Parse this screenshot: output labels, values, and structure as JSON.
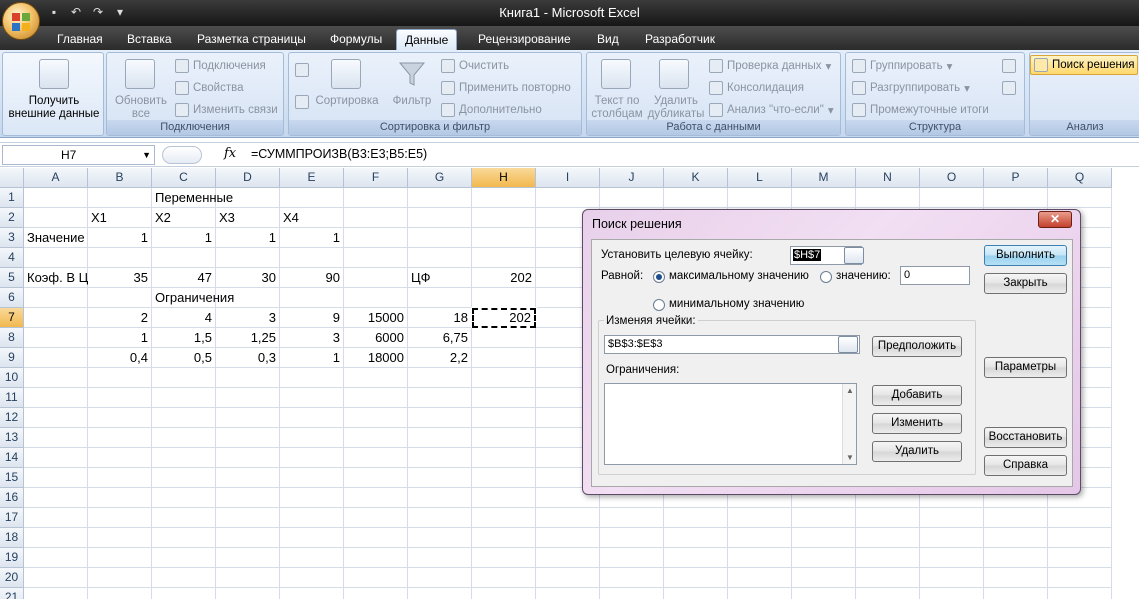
{
  "window": {
    "title": "Книга1 - Microsoft Excel"
  },
  "qat": {
    "save": "save-icon",
    "undo": "undo-icon",
    "redo": "redo-icon",
    "customize": "customize-qat-icon"
  },
  "tabs": [
    {
      "label": "Главная"
    },
    {
      "label": "Вставка"
    },
    {
      "label": "Разметка страницы"
    },
    {
      "label": "Формулы"
    },
    {
      "label": "Данные"
    },
    {
      "label": "Рецензирование"
    },
    {
      "label": "Вид"
    },
    {
      "label": "Разработчик"
    }
  ],
  "active_tab": "Данные",
  "ribbon": {
    "external": {
      "line1": "Получить",
      "line2": "внешние данные"
    },
    "connections": {
      "refresh_line1": "Обновить",
      "refresh_line2": "все",
      "connections": "Подключения",
      "properties": "Свойства",
      "edit_links": "Изменить связи",
      "group_label": "Подключения"
    },
    "sort_filter": {
      "sort": "Сортировка",
      "filter": "Фильтр",
      "clear": "Очистить",
      "reapply": "Применить повторно",
      "advanced": "Дополнительно",
      "group_label": "Сортировка и фильтр"
    },
    "data_tools": {
      "text_to_cols_line1": "Текст по",
      "text_to_cols_line2": "столбцам",
      "remove_dup_line1": "Удалить",
      "remove_dup_line2": "дубликаты",
      "validation": "Проверка данных",
      "consolidate": "Консолидация",
      "what_if": "Анализ \"что-если\"",
      "group_label": "Работа с данными"
    },
    "outline": {
      "group": "Группировать",
      "ungroup": "Разгруппировать",
      "subtotal": "Промежуточные итоги",
      "group_label": "Структура"
    },
    "analysis": {
      "solver": "Поиск решения",
      "group_label": "Анализ"
    }
  },
  "formula_bar": {
    "name_box": "H7",
    "fx": "fx",
    "formula": "=СУММПРОИЗВ(B3:E3;B5:E5)"
  },
  "sheet": {
    "columns": [
      "A",
      "B",
      "C",
      "D",
      "E",
      "F",
      "G",
      "H",
      "I",
      "J",
      "K",
      "L",
      "M",
      "N",
      "O",
      "P",
      "Q"
    ],
    "rows": [
      "1",
      "2",
      "3",
      "4",
      "5",
      "6",
      "7",
      "8",
      "9",
      "10",
      "11",
      "12",
      "13",
      "14",
      "15",
      "16",
      "17",
      "18",
      "19",
      "20",
      "21"
    ],
    "selected_col": "H",
    "selected_row": "7",
    "cells": [
      {
        "ref": "C1",
        "value": "Переменные",
        "num": false
      },
      {
        "ref": "B2",
        "value": "X1",
        "num": false
      },
      {
        "ref": "C2",
        "value": "X2",
        "num": false
      },
      {
        "ref": "D2",
        "value": "X3",
        "num": false
      },
      {
        "ref": "E2",
        "value": "X4",
        "num": false
      },
      {
        "ref": "A3",
        "value": "Значение",
        "num": false
      },
      {
        "ref": "B3",
        "value": "1",
        "num": true
      },
      {
        "ref": "C3",
        "value": "1",
        "num": true
      },
      {
        "ref": "D3",
        "value": "1",
        "num": true
      },
      {
        "ref": "E3",
        "value": "1",
        "num": true
      },
      {
        "ref": "A5",
        "value": "Коэф. В Ц",
        "num": false
      },
      {
        "ref": "B5",
        "value": "35",
        "num": true
      },
      {
        "ref": "C5",
        "value": "47",
        "num": true
      },
      {
        "ref": "D5",
        "value": "30",
        "num": true
      },
      {
        "ref": "E5",
        "value": "90",
        "num": true
      },
      {
        "ref": "G5",
        "value": "ЦФ",
        "num": false
      },
      {
        "ref": "H5",
        "value": "202",
        "num": true
      },
      {
        "ref": "C6",
        "value": "Ограничения",
        "num": false
      },
      {
        "ref": "B7",
        "value": "2",
        "num": true
      },
      {
        "ref": "C7",
        "value": "4",
        "num": true
      },
      {
        "ref": "D7",
        "value": "3",
        "num": true
      },
      {
        "ref": "E7",
        "value": "9",
        "num": true
      },
      {
        "ref": "F7",
        "value": "15000",
        "num": true
      },
      {
        "ref": "G7",
        "value": "18",
        "num": true
      },
      {
        "ref": "H7",
        "value": "202",
        "num": true
      },
      {
        "ref": "B8",
        "value": "1",
        "num": true
      },
      {
        "ref": "C8",
        "value": "1,5",
        "num": true
      },
      {
        "ref": "D8",
        "value": "1,25",
        "num": true
      },
      {
        "ref": "E8",
        "value": "3",
        "num": true
      },
      {
        "ref": "F8",
        "value": "6000",
        "num": true
      },
      {
        "ref": "G8",
        "value": "6,75",
        "num": true
      },
      {
        "ref": "B9",
        "value": "0,4",
        "num": true
      },
      {
        "ref": "C9",
        "value": "0,5",
        "num": true
      },
      {
        "ref": "D9",
        "value": "0,3",
        "num": true
      },
      {
        "ref": "E9",
        "value": "1",
        "num": true
      },
      {
        "ref": "F9",
        "value": "18000",
        "num": true
      },
      {
        "ref": "G9",
        "value": "2,2",
        "num": true
      }
    ]
  },
  "solver": {
    "title": "Поиск решения",
    "close": "✕",
    "target_label": "Установить целевую ячейку:",
    "target_value": "$H$7",
    "equal_label": "Равной:",
    "max_label": "максимальному значению",
    "value_label": "значению:",
    "value_input": "0",
    "min_label": "минимальному значению",
    "changing_label": "Изменяя ячейки:",
    "changing_value": "$B$3:$E$3",
    "constraints_label": "Ограничения:",
    "selected_option": "max",
    "buttons": {
      "solve": "Выполнить",
      "close": "Закрыть",
      "guess": "Предположить",
      "options": "Параметры",
      "add": "Добавить",
      "change": "Изменить",
      "delete": "Удалить",
      "reset": "Восстановить",
      "help": "Справка"
    }
  }
}
